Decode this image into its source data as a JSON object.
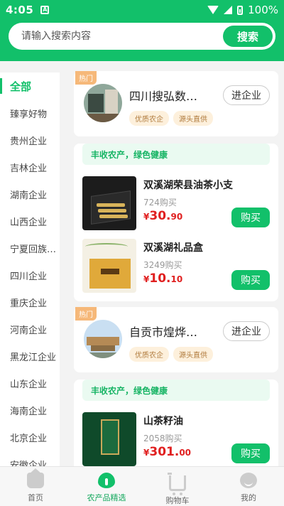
{
  "status_bar": {
    "time": "4:05",
    "notification": "A",
    "battery": "100%"
  },
  "search": {
    "placeholder": "请输入搜索内容",
    "button": "搜索"
  },
  "sidebar": {
    "items": [
      {
        "label": "全部",
        "active": true
      },
      {
        "label": "臻享好物"
      },
      {
        "label": "贵州企业"
      },
      {
        "label": "吉林企业"
      },
      {
        "label": "湖南企业"
      },
      {
        "label": "山西企业"
      },
      {
        "label": "宁夏回族…"
      },
      {
        "label": "四川企业"
      },
      {
        "label": "重庆企业"
      },
      {
        "label": "河南企业"
      },
      {
        "label": "黑龙江企业"
      },
      {
        "label": "山东企业"
      },
      {
        "label": "海南企业"
      },
      {
        "label": "北京企业"
      },
      {
        "label": "安徽企业"
      }
    ]
  },
  "companies": [
    {
      "badge": "热门",
      "name": "四川搜弘数…",
      "tags": [
        "优质农企",
        "源头直供"
      ],
      "button": "进企业",
      "slogan": "丰收农产，绿色健康",
      "products": [
        {
          "title": "双溪湖荣县油茶小支",
          "sold": "724购买",
          "price_symbol": "¥",
          "price_int": "30.",
          "price_dec": "90",
          "button": "购买"
        },
        {
          "title": "双溪湖礼品盒",
          "sold": "3249购买",
          "price_symbol": "¥",
          "price_int": "10.",
          "price_dec": "10",
          "button": "购买"
        }
      ]
    },
    {
      "badge": "热门",
      "name": "自贡市煌烨…",
      "tags": [
        "优质农企",
        "源头直供"
      ],
      "button": "进企业",
      "slogan": "丰收农产，绿色健康",
      "products": [
        {
          "title": "山茶籽油",
          "sold": "2058购买",
          "price_symbol": "¥",
          "price_int": "301.",
          "price_dec": "00",
          "button": "购买"
        }
      ]
    }
  ],
  "tabbar": {
    "items": [
      {
        "label": "首页",
        "icon": "home-icon"
      },
      {
        "label": "农产品精选",
        "icon": "leaf-icon",
        "active": true
      },
      {
        "label": "购物车",
        "icon": "cart-icon"
      },
      {
        "label": "我的",
        "icon": "profile-icon"
      }
    ]
  },
  "colors": {
    "primary": "#12c06a",
    "price": "#e02020",
    "tag_bg": "#fdf0dc"
  }
}
